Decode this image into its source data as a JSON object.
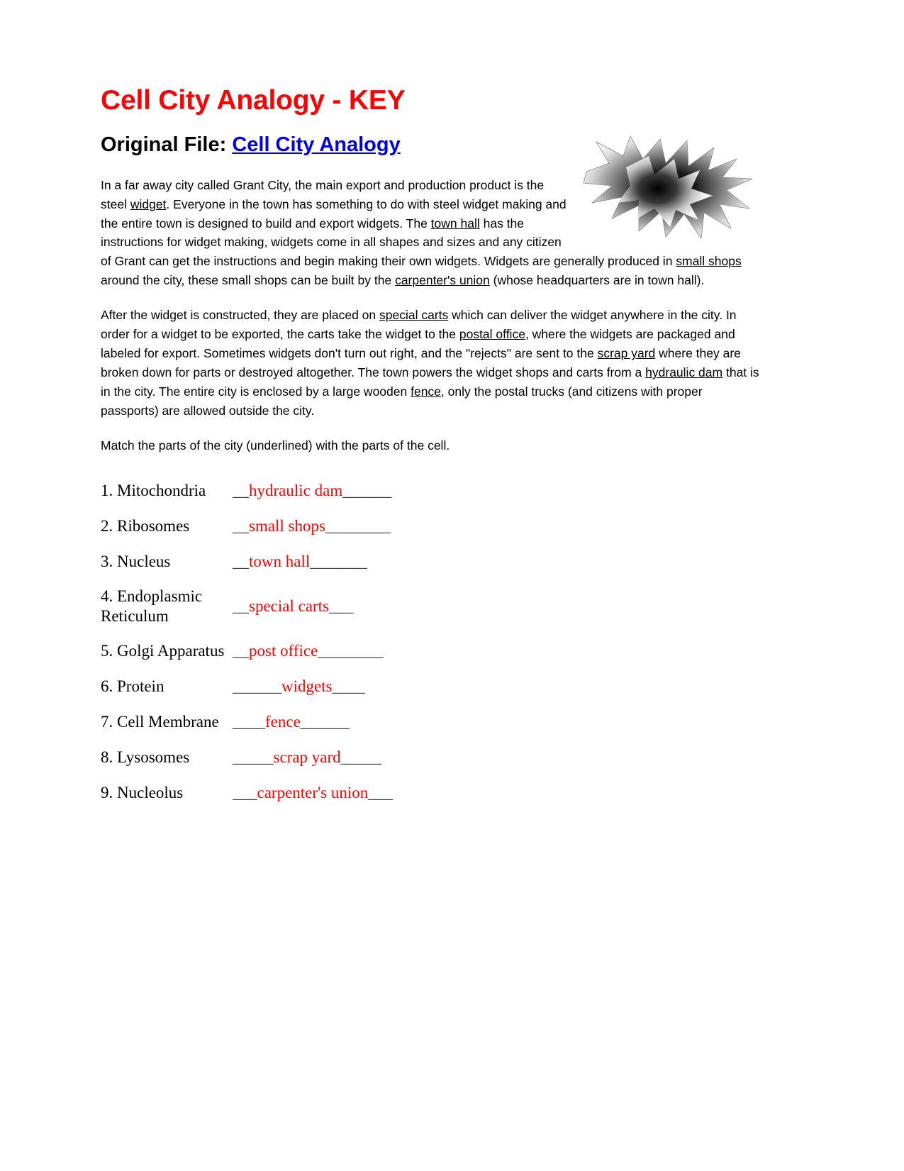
{
  "document": {
    "title": "Cell City Analogy - KEY",
    "subtitle_prefix": "Original File:",
    "subtitle_link": "Cell City Analogy",
    "link_color": "#0000ee",
    "title_color": "#ff0000",
    "answer_color": "#ff0000"
  },
  "paragraphs": {
    "p1": {
      "s1": "In a far away city called Grant City, the main export and production product is the steel ",
      "u1": "widget",
      "s2": ". Everyone in the town has something to do with steel widget making and the entire town is designed to build and export widgets. The ",
      "u2": "town hall",
      "s3": " has the instructions for widget making, widgets come in all shapes and sizes and any citizen of Grant can get the instructions and begin making their own widgets. Widgets are generally produced in ",
      "u3": "small shops",
      "s4": " around the city, these small shops can be built by the ",
      "u4": "carpenter's union",
      "s5": " (whose headquarters are in town hall)."
    },
    "p2": {
      "s1": "After the widget is constructed, they are placed on ",
      "u1": "special carts",
      "s2": " which can deliver the widget anywhere in the city. In order for a widget to be exported, the carts take the widget to the ",
      "u2": "postal office",
      "s3": ", where the widgets are packaged and labeled for export. Sometimes widgets don't turn out right, and the \"rejects\" are sent to the ",
      "u3": "scrap yard",
      "s4": " where they are broken down for parts or destroyed altogether. The town powers the widget shops and carts from a ",
      "u4": "hydraulic dam",
      "s5": " that is in the city. The entire city is enclosed by a large wooden ",
      "u5": "fence",
      "s6": ", only the postal trucks (and citizens with proper passports) are allowed outside the city."
    },
    "instruction": "Match the parts of the city (underlined) with the parts of the cell."
  },
  "match_list": [
    {
      "term": "1. Mitochondria",
      "lead": "__",
      "answer": "hydraulic dam",
      "trail": "______"
    },
    {
      "term": "2. Ribosomes",
      "lead": "__",
      "answer": "small shops",
      "trail": "________"
    },
    {
      "term": "3. Nucleus",
      "lead": "__",
      "answer": "town hall",
      "trail": "_______"
    },
    {
      "term": "4. Endoplasmic Reticulum",
      "lead": "__",
      "answer": "special carts",
      "trail": "___"
    },
    {
      "term": "5. Golgi Apparatus",
      "lead": "__",
      "answer": "post office",
      "trail": "________"
    },
    {
      "term": "6. Protein",
      "lead": "______",
      "answer": "widgets",
      "trail": "____"
    },
    {
      "term": "7. Cell Membrane",
      "lead": "____",
      "answer": "fence",
      "trail": "______"
    },
    {
      "term": "8. Lysosomes",
      "lead": "_____",
      "answer": "scrap yard",
      "trail": "_____"
    },
    {
      "term": "9. Nucleolus",
      "lead": "___",
      "answer": "carpenter's union",
      "trail": "___"
    }
  ],
  "decoration": {
    "icon": "starburst-splat-image"
  }
}
